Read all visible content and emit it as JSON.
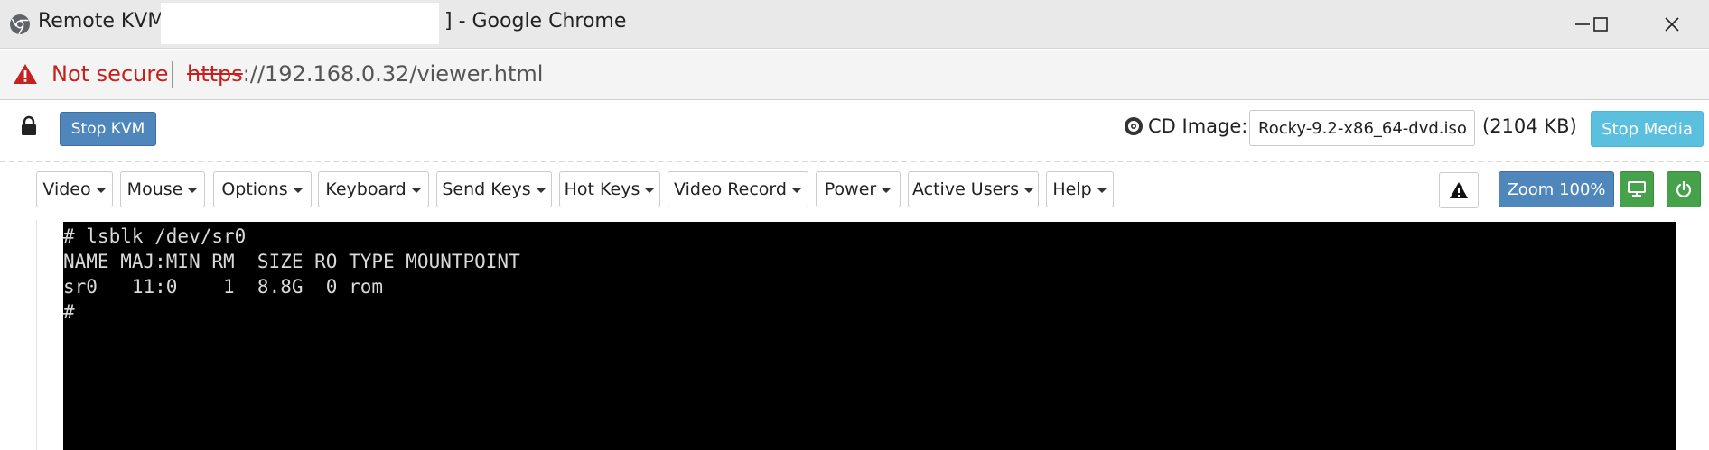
{
  "window": {
    "title_prefix": "Remote KVM [",
    "title_suffix": "] - Google Chrome",
    "icons": [
      "chrome-icon",
      "minimize-icon",
      "maximize-icon",
      "close-icon"
    ]
  },
  "address_bar": {
    "security_text": "Not secure",
    "url_scheme": "https",
    "url_rest": "://192.168.0.32/viewer.html",
    "colors": {
      "warning": "#c5221f"
    }
  },
  "kvm_toolbar": {
    "stop_kvm_label": "Stop KVM",
    "cd_image_label": "CD Image:",
    "cd_image_value": "Rocky-9.2-x86_64-dvd.iso",
    "cd_image_size": "(2104 KB)",
    "stop_media_label": "Stop Media",
    "colors": {
      "primary": "#4f87bd",
      "info": "#5bc0de",
      "success": "#46a14b"
    }
  },
  "menu": {
    "items": [
      {
        "label": "Video"
      },
      {
        "label": "Mouse"
      },
      {
        "label": "Options"
      },
      {
        "label": "Keyboard"
      },
      {
        "label": "Send Keys"
      },
      {
        "label": "Hot Keys"
      },
      {
        "label": "Video Record"
      },
      {
        "label": "Power"
      },
      {
        "label": "Active Users"
      },
      {
        "label": "Help"
      }
    ],
    "zoom_label": "Zoom 100%"
  },
  "console": {
    "lines": [
      "# lsblk /dev/sr0",
      "NAME MAJ:MIN RM  SIZE RO TYPE MOUNTPOINT",
      "sr0   11:0    1  8.8G  0 rom",
      "#"
    ]
  }
}
